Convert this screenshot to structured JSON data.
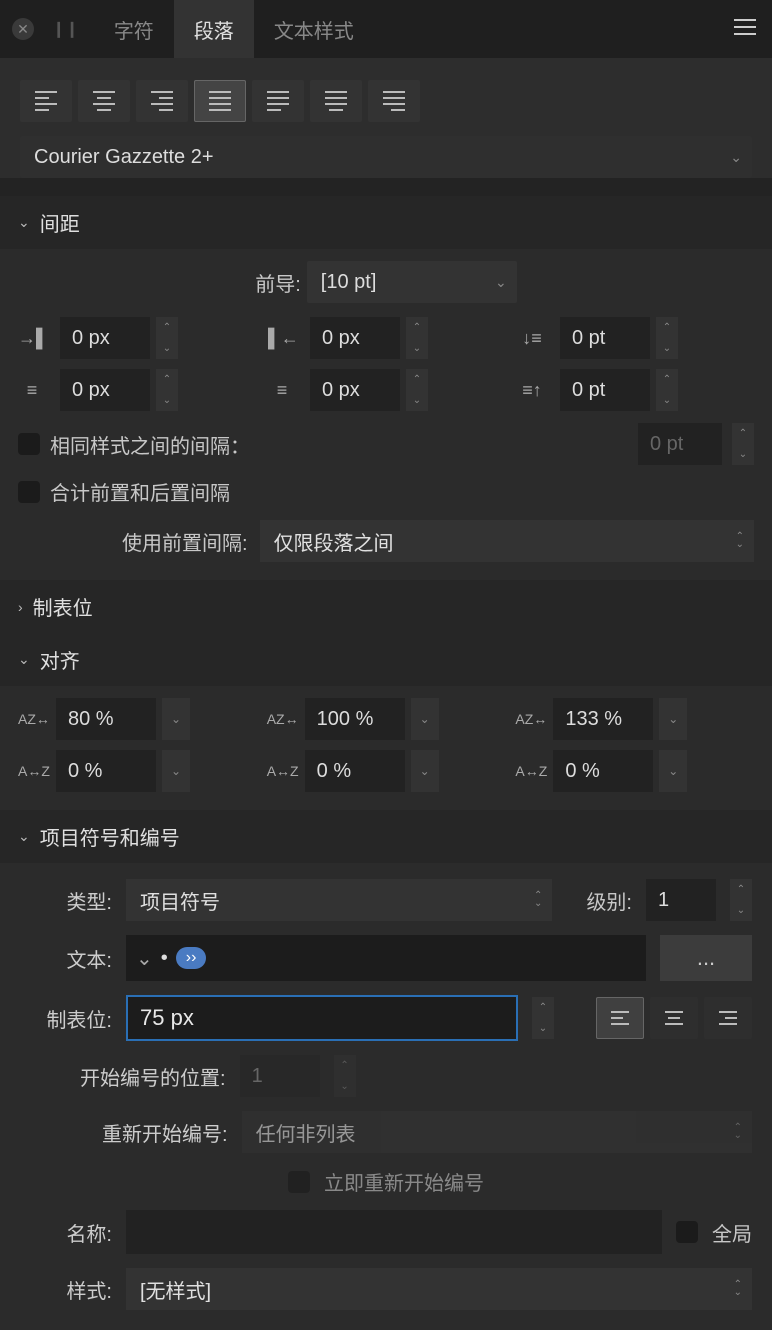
{
  "tabs": {
    "char": "字符",
    "para": "段落",
    "style": "文本样式"
  },
  "style_select": "Courier Gazzette 2+",
  "spacing": {
    "title": "间距",
    "leading_label": "前导:",
    "leading_value": "[10 pt]",
    "left_indent": "0 px",
    "right_indent": "0 px",
    "space_before_top": "0 pt",
    "first_line": "0 px",
    "last_line": "0 px",
    "space_after_bottom": "0 pt",
    "same_style_label": "相同样式之间的间隔：",
    "same_style_value": "0 pt",
    "sum_label": "合计前置和后置间隔",
    "use_before_label": "使用前置间隔:",
    "use_before_value": "仅限段落之间"
  },
  "tabstops": {
    "title": "制表位"
  },
  "justify": {
    "title": "对齐",
    "v1": "80 %",
    "v2": "100 %",
    "v3": "133 %",
    "v4": "0 %",
    "v5": "0 %",
    "v6": "0 %"
  },
  "bullets": {
    "title": "项目符号和编号",
    "type_label": "类型:",
    "type_value": "项目符号",
    "level_label": "级别:",
    "level_value": "1",
    "text_label": "文本:",
    "bullet_glyph": "•",
    "more": "...",
    "tab_label": "制表位:",
    "tab_value": "75 px",
    "start_at_label": "开始编号的位置:",
    "start_at_value": "1",
    "restart_label": "重新开始编号:",
    "restart_value": "任何非列表",
    "restart_now_label": "立即重新开始编号",
    "name_label": "名称:",
    "global_label": "全局",
    "style_label": "样式:",
    "style_value": "[无样式]"
  }
}
